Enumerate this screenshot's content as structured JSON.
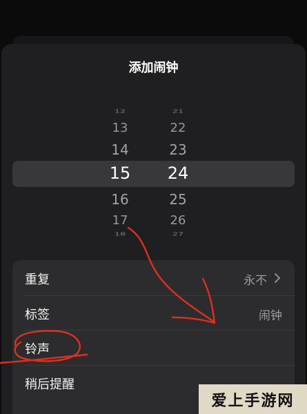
{
  "sheet": {
    "title": "添加闹钟"
  },
  "picker": {
    "hours": [
      "12",
      "13",
      "14",
      "15",
      "16",
      "17",
      "18"
    ],
    "minutes": [
      "21",
      "22",
      "23",
      "24",
      "25",
      "26",
      "27"
    ],
    "selected_hour": "15",
    "selected_minute": "24"
  },
  "settings": {
    "rows": [
      {
        "label": "重复",
        "value": "永不"
      },
      {
        "label": "标签",
        "value": "闹钟"
      },
      {
        "label": "铃声",
        "value": ""
      },
      {
        "label": "稍后提醒",
        "value": ""
      }
    ]
  },
  "watermark": {
    "text": "爱上手游网"
  },
  "colors": {
    "annotation_red": "#e0301e",
    "sheet_bg": "#1f1f21",
    "group_bg": "#2c2c2e"
  }
}
